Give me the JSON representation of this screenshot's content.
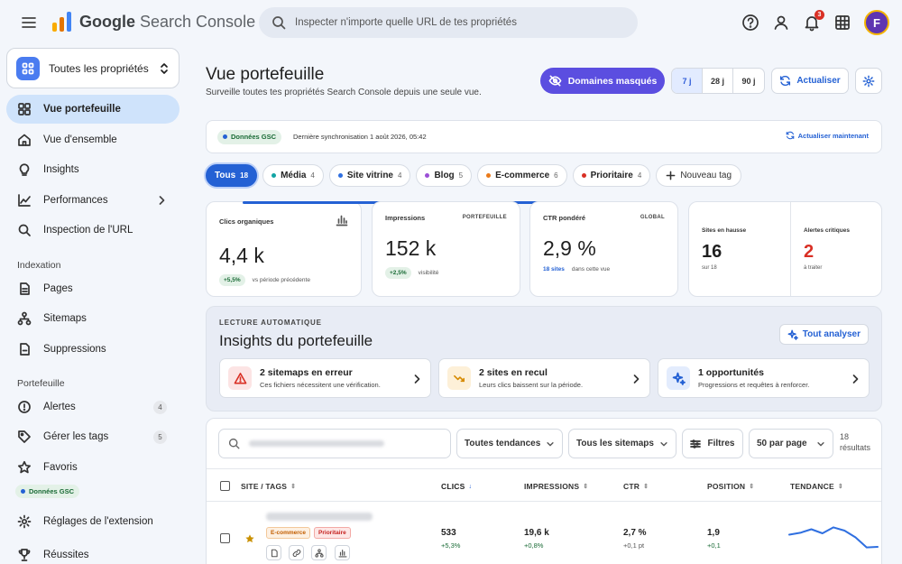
{
  "app": {
    "brand_strong": "Google",
    "brand_rest": " Search Console"
  },
  "search": {
    "placeholder": "Inspecter n'importe quelle URL de tes propriétés"
  },
  "header": {
    "notifications_count": "3",
    "avatar_initial": "F"
  },
  "colors": {
    "accent": "#2461d4",
    "masked_button": "#5b4ee0",
    "positive": "#1a6b36",
    "danger": "#d93025",
    "active_nav": "#cfe3fb"
  },
  "sidebar": {
    "property": "Toutes les propriétés",
    "items": [
      {
        "label": "Vue portefeuille",
        "icon": "dashboard-icon"
      },
      {
        "label": "Vue d'ensemble",
        "icon": "home-icon"
      },
      {
        "label": "Insights",
        "icon": "lightbulb-icon"
      },
      {
        "label": "Performances",
        "icon": "trending-icon"
      },
      {
        "label": "Inspection de l'URL",
        "icon": "search-icon"
      }
    ],
    "indexation_label": "Indexation",
    "indexation_items": [
      {
        "label": "Pages",
        "icon": "pages-icon"
      },
      {
        "label": "Sitemaps",
        "icon": "sitemap-icon"
      },
      {
        "label": "Suppressions",
        "icon": "remove-icon"
      }
    ],
    "portfolio_label": "Portefeuille",
    "portfolio_items": [
      {
        "label": "Alertes",
        "count": "4",
        "icon": "alert-icon"
      },
      {
        "label": "Gérer les tags",
        "count": "5",
        "icon": "tag-icon"
      },
      {
        "label": "Favoris",
        "icon": "star-icon"
      }
    ],
    "gsc_badge": "Données GSC",
    "footer_items": [
      {
        "label": "Réglages de l'extension",
        "icon": "settings-icon"
      },
      {
        "label": "Réussites",
        "icon": "trophy-icon"
      }
    ]
  },
  "main": {
    "title": "Vue portefeuille",
    "subtitle": "Surveille toutes tes propriétés Search Console depuis une seule vue.",
    "masked_button": "Domaines masqués",
    "periods": [
      "7 j",
      "28 j",
      "90 j"
    ],
    "selected_period": "7 j",
    "refresh_button": "Actualiser",
    "sync": {
      "badge": "Données GSC",
      "text": "Dernière synchronisation 1 août 2026, 05:42",
      "action": "Actualiser maintenant"
    }
  },
  "tags": [
    {
      "label": "Tous",
      "count": "18",
      "color": "#2461d4",
      "selected": true
    },
    {
      "label": "Média",
      "count": "4",
      "color": "#12a4a4"
    },
    {
      "label": "Site vitrine",
      "count": "4",
      "color": "#2f6fe0"
    },
    {
      "label": "Blog",
      "count": "5",
      "color": "#9c4fd6"
    },
    {
      "label": "E-commerce",
      "count": "6",
      "color": "#ea7a1a"
    },
    {
      "label": "Prioritaire",
      "count": "4",
      "color": "#d93025"
    }
  ],
  "new_tag_label": "Nouveau tag",
  "kpis": {
    "clics": {
      "label": "Clics organiques",
      "value": "4,4 k",
      "change": "+5,5%",
      "change_note": "vs période précédente"
    },
    "impressions": {
      "label": "Impressions",
      "tag": "PORTEFEUILLE",
      "value": "152 k",
      "change": "+2,5%",
      "change_note": "visibilité"
    },
    "ctr": {
      "label": "CTR pondéré",
      "tag": "GLOBAL",
      "value": "2,9 %",
      "sites_link": "18 sites",
      "note": "dans cette vue"
    },
    "rising": {
      "label": "Sites en hausse",
      "value": "16",
      "note": "sur 18"
    },
    "critical": {
      "label": "Alertes critiques",
      "value": "2",
      "note": "à traiter"
    }
  },
  "insights": {
    "kicker": "LECTURE AUTOMATIQUE",
    "title": "Insights du portefeuille",
    "analyze_button": "Tout analyser",
    "cards": [
      {
        "title": "2 sitemaps en erreur",
        "desc": "Ces fichiers nécessitent une vérification.",
        "icon": "warning-icon"
      },
      {
        "title": "2 sites en recul",
        "desc": "Leurs clics baissent sur la période.",
        "icon": "trending-down-icon"
      },
      {
        "title": "1 opportunités",
        "desc": "Progressions et requêtes à renforcer.",
        "icon": "sparkle-icon"
      }
    ]
  },
  "table": {
    "filters": {
      "trend": "Toutes tendances",
      "sitemaps": "Tous les sitemaps",
      "filters_button": "Filtres",
      "per_page": "50 par page"
    },
    "results_count": "18",
    "results_label": "résultats",
    "columns": [
      "SITE / TAGS",
      "CLICS",
      "IMPRESSIONS",
      "CTR",
      "POSITION",
      "TENDANCE"
    ],
    "rows": [
      {
        "tags": [
          {
            "label": "E-commerce"
          },
          {
            "label": "Prioritaire"
          }
        ],
        "clics": "533",
        "clics_delta": "+5,3%",
        "impressions": "19,6 k",
        "impressions_delta": "+0,8%",
        "ctr": "2,7 %",
        "ctr_delta": "+0,1 pt",
        "position": "1,9",
        "position_delta": "+0,1",
        "trend": [
          0.55,
          0.62,
          0.75,
          0.6,
          0.82,
          0.7,
          0.45,
          0.08,
          0.1
        ]
      }
    ]
  }
}
